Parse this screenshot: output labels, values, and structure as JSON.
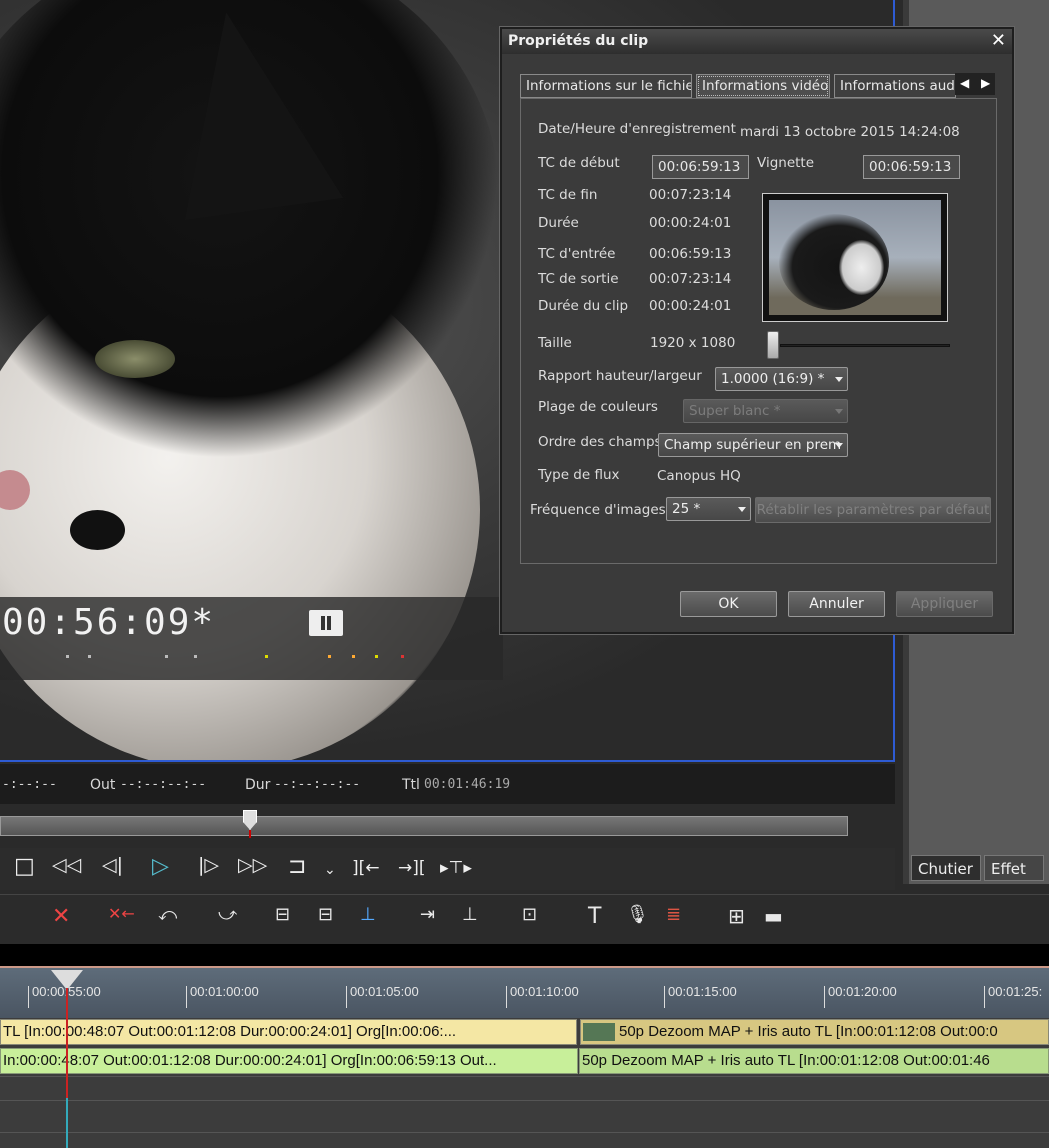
{
  "player": {
    "timecode": "00:56:09*",
    "in_label": "-:--:--",
    "out_label": "Out",
    "out_value": "--:--:--:--",
    "dur_label": "Dur",
    "dur_value": "--:--:--:--",
    "ttl_label": "Ttl",
    "ttl_value": "00:01:46:19"
  },
  "transport": {
    "stop": "□",
    "rewind": "◁◁",
    "step_back": "◁|",
    "play": "▷",
    "step_fwd": "|▷",
    "ffwd": "▷▷",
    "loop": "⊐",
    "mark_in": "][←",
    "mark_out": "→][",
    "split": "▸⊤▸",
    "more": "⌄"
  },
  "right_panel": {
    "tabs": [
      "Chutier",
      "Effet"
    ]
  },
  "toolbar": {
    "delete_icon": "✕",
    "title_tool": "T",
    "mic_icon": "🎙",
    "grid_icon": "⊞"
  },
  "timeline": {
    "ruler_labels": [
      "00:00:55:00",
      "00:01:00:00",
      "00:01:05:00",
      "00:01:10:00",
      "00:01:15:00",
      "00:01:20:00",
      "00:01:25:"
    ],
    "track1": {
      "clip1": "TL [In:00:00:48:07 Out:00:01:12:08 Dur:00:00:24:01]  Org[In:00:06:...",
      "clip2": "50p Dezoom MAP + Iris auto  TL [In:00:01:12:08 Out:00:0"
    },
    "track2": {
      "clip1": "In:00:00:48:07 Out:00:01:12:08 Dur:00:00:24:01]  Org[In:00:06:59:13 Out...",
      "clip2": "50p Dezoom MAP + Iris auto  TL [In:00:01:12:08 Out:00:01:46"
    }
  },
  "dialog": {
    "title": "Propriétés du clip",
    "close": "✕",
    "tabs": [
      "Informations sur le fichier",
      "Informations vidéo",
      "Informations audi"
    ],
    "tab_prev": "◀",
    "tab_next": "▶",
    "fields": {
      "rec_date_label": "Date/Heure d'enregistrement",
      "rec_date_value": "mardi 13 octobre 2015 14:24:08",
      "tc_start_label": "TC de début",
      "tc_start_value": "00:06:59:13",
      "thumb_label": "Vignette",
      "thumb_value": "00:06:59:13",
      "tc_end_label": "TC de fin",
      "tc_end_value": "00:07:23:14",
      "duration_label": "Durée",
      "duration_value": "00:00:24:01",
      "tc_in_label": "TC d'entrée",
      "tc_in_value": "00:06:59:13",
      "tc_out_label": "TC de sortie",
      "tc_out_value": "00:07:23:14",
      "clip_dur_label": "Durée du clip",
      "clip_dur_value": "00:00:24:01",
      "size_label": "Taille",
      "size_value": "1920 x 1080",
      "aspect_label": "Rapport hauteur/largeur",
      "aspect_value": "1.0000 (16:9) *",
      "color_range_label": "Plage de couleurs",
      "color_range_value": "Super blanc *",
      "field_order_label": "Ordre des champs",
      "field_order_value": "Champ supérieur en prem",
      "stream_type_label": "Type de flux",
      "stream_type_value": "Canopus HQ",
      "framerate_label": "Fréquence d'images",
      "framerate_value": "25 *",
      "reset_button": "Rétablir les paramètres par défaut"
    },
    "buttons": {
      "ok": "OK",
      "cancel": "Annuler",
      "apply": "Appliquer"
    }
  }
}
